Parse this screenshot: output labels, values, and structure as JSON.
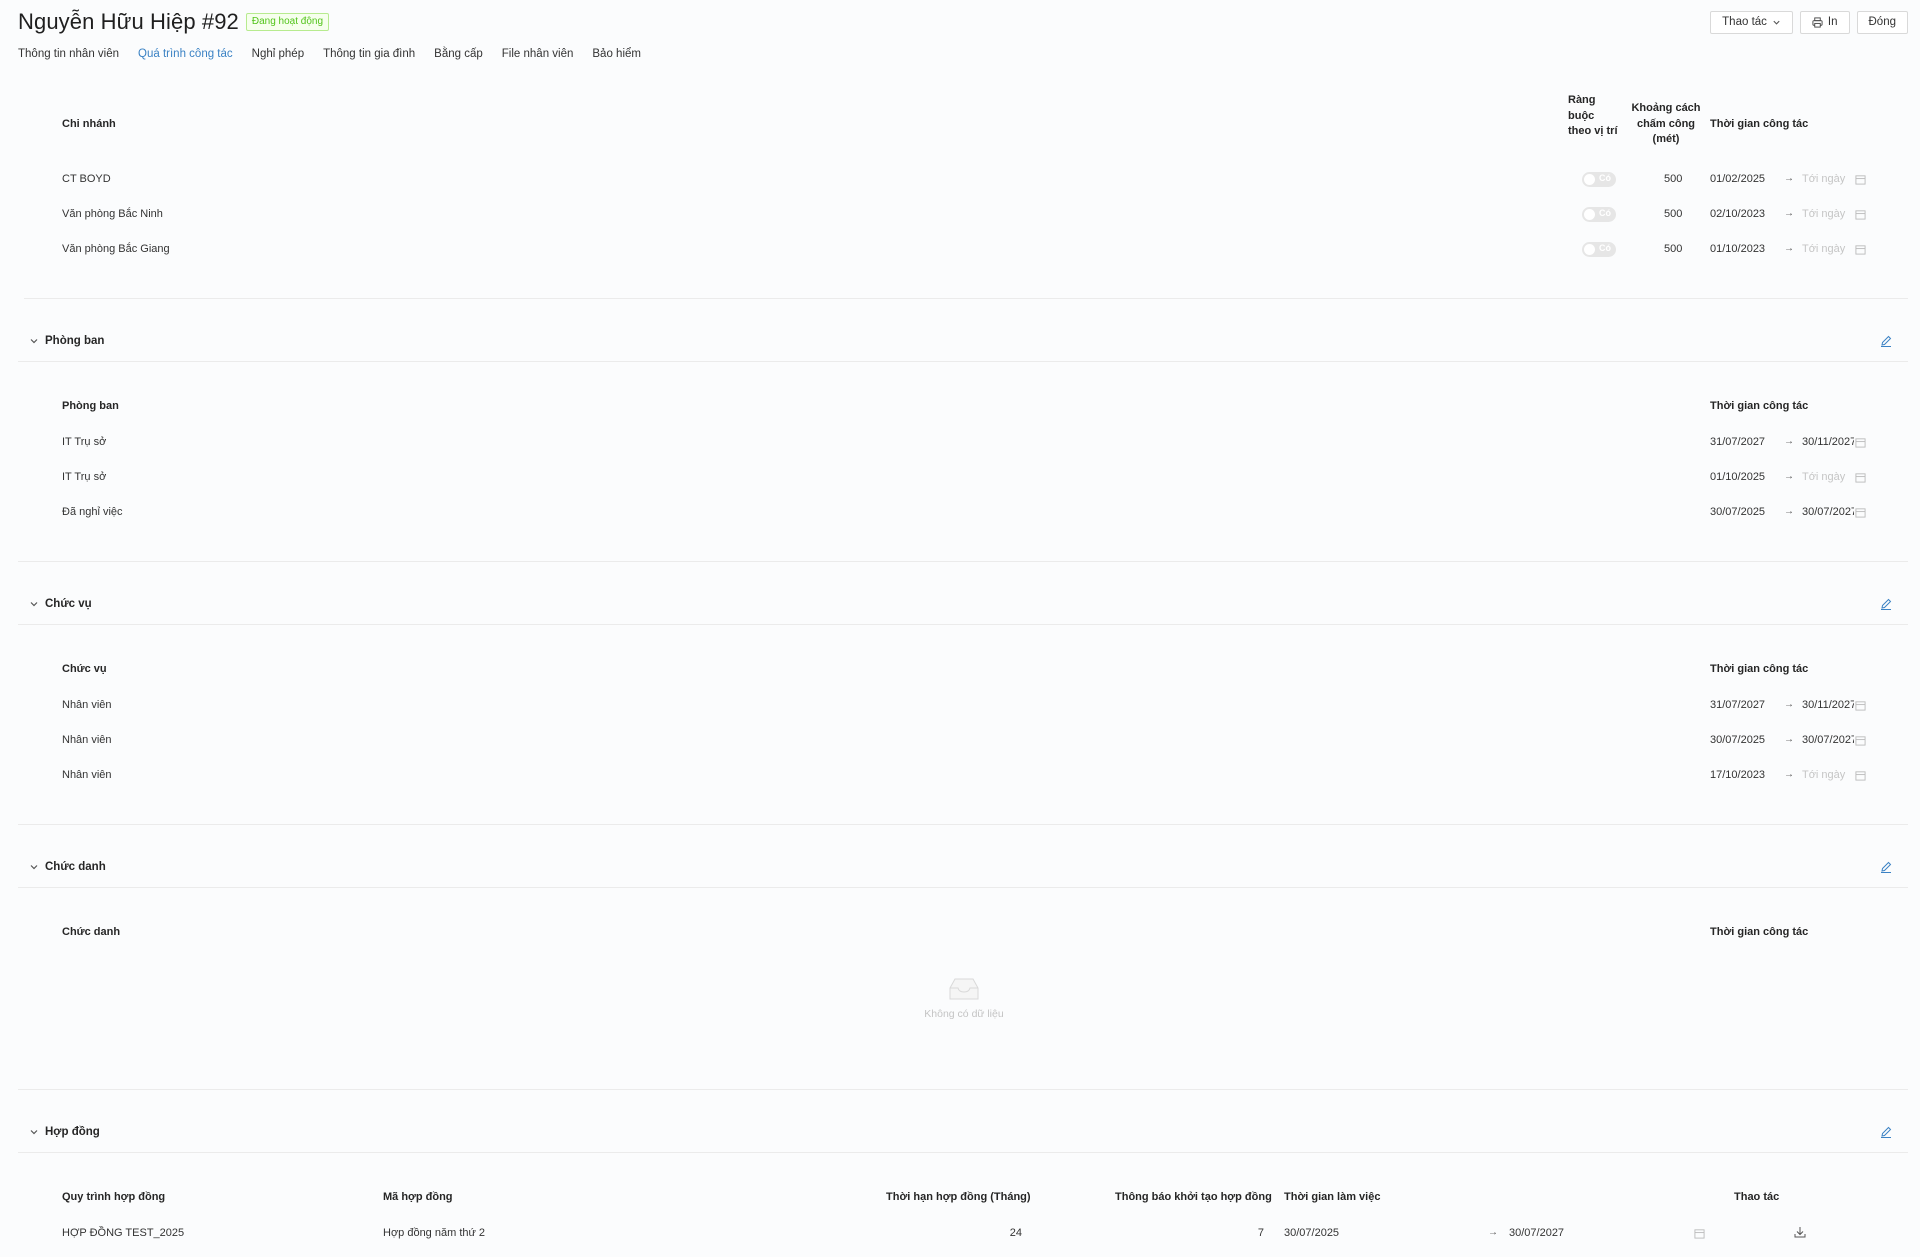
{
  "header": {
    "title": "Nguyễn Hữu Hiệp #92",
    "status": "Đang hoạt động",
    "actions_label": "Thao tác",
    "print_label": "In",
    "close_label": "Đóng"
  },
  "tabs": [
    {
      "label": "Thông tin nhân viên"
    },
    {
      "label": "Quá trình công tác"
    },
    {
      "label": "Nghỉ phép"
    },
    {
      "label": "Thông tin gia đình"
    },
    {
      "label": "Bằng cấp"
    },
    {
      "label": "File nhân viên"
    },
    {
      "label": "Bảo hiểm"
    }
  ],
  "branch": {
    "headers": {
      "name": "Chi nhánh",
      "bound": "Ràng buộc theo vị trí",
      "distance": "Khoảng cách chấm công (mét)",
      "time": "Thời gian công tác"
    },
    "rows": [
      {
        "name": "CT BOYD",
        "toggle": "Có",
        "distance": "500",
        "start": "01/02/2025",
        "end": "Tới ngày"
      },
      {
        "name": "Văn phòng Bắc Ninh",
        "toggle": "Có",
        "distance": "500",
        "start": "02/10/2023",
        "end": "Tới ngày"
      },
      {
        "name": "Văn phòng Bắc Giang",
        "toggle": "Có",
        "distance": "500",
        "start": "01/10/2023",
        "end": "Tới ngày"
      }
    ]
  },
  "department": {
    "title": "Phòng ban",
    "headers": {
      "name": "Phòng ban",
      "time": "Thời gian công tác"
    },
    "rows": [
      {
        "name": "IT Trụ sở",
        "start": "31/07/2027",
        "end": "30/11/2027"
      },
      {
        "name": "IT Trụ sở",
        "start": "01/10/2025",
        "end": "Tới ngày"
      },
      {
        "name": "Đã nghỉ việc",
        "start": "30/07/2025",
        "end": "30/07/2027"
      }
    ]
  },
  "position": {
    "title": "Chức vụ",
    "headers": {
      "name": "Chức vụ",
      "time": "Thời gian công tác"
    },
    "rows": [
      {
        "name": "Nhân viên",
        "start": "31/07/2027",
        "end": "30/11/2027"
      },
      {
        "name": "Nhân viên",
        "start": "30/07/2025",
        "end": "30/07/2027"
      },
      {
        "name": "Nhân viên",
        "start": "17/10/2023",
        "end": "Tới ngày"
      }
    ]
  },
  "jobtitle": {
    "title": "Chức danh",
    "headers": {
      "name": "Chức danh",
      "time": "Thời gian công tác"
    },
    "empty": "Không có dữ liệu"
  },
  "contract": {
    "title": "Hợp đồng",
    "headers": {
      "process": "Quy trình hợp đồng",
      "code": "Mã hợp đồng",
      "term": "Thời hạn hợp đồng (Tháng)",
      "notice": "Thông báo khởi tạo hợp đồng",
      "worktime": "Thời gian làm việc",
      "actions": "Thao tác"
    },
    "rows": [
      {
        "process": "HỢP ĐỒNG TEST_2025",
        "code": "Hợp đồng năm thứ 2",
        "term": "24",
        "notice": "7",
        "start": "30/07/2025",
        "end": "30/07/2027"
      }
    ]
  },
  "colors": {
    "accent": "#3b82c4",
    "success": "#52c41a",
    "muted": "#c5c5c5",
    "border": "#ebebeb"
  },
  "icons": {
    "chevron": "chevron-down-icon",
    "edit": "edit-icon",
    "calendar": "calendar-icon",
    "print": "printer-icon",
    "download": "download-icon",
    "empty": "empty-inbox-icon"
  }
}
